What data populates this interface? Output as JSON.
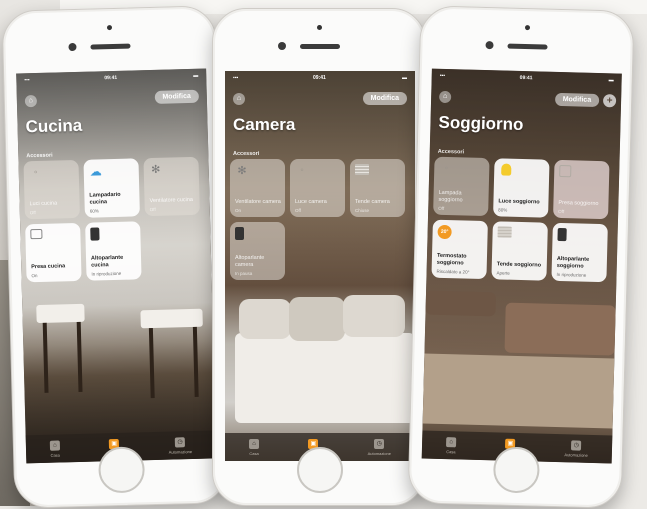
{
  "phones": [
    {
      "room": "Cucina",
      "edit_label": "Modifica",
      "status_time": "09:41",
      "section": "Accessori",
      "tiles": [
        {
          "name": "Luci cucina",
          "status": "Off",
          "icon": "bulb-icon",
          "state": "off"
        },
        {
          "name": "Lampadario cucina",
          "status": "60%",
          "icon": "cloud-icon",
          "state": "on"
        },
        {
          "name": "Ventilatore cucina",
          "status": "Off",
          "icon": "fan-icon",
          "state": "off"
        },
        {
          "name": "Presa cucina",
          "status": "On",
          "icon": "plug-icon",
          "state": "on"
        },
        {
          "name": "Altoparlante cucina",
          "status": "In riproduzione",
          "icon": "speaker-icon",
          "state": "on"
        }
      ],
      "tabs": [
        {
          "label": "Casa",
          "icon": "house-icon"
        },
        {
          "label": "Stanze",
          "icon": "rooms-icon",
          "active": true
        },
        {
          "label": "Automazione",
          "icon": "automation-icon"
        }
      ]
    },
    {
      "room": "Camera",
      "edit_label": "Modifica",
      "status_time": "09:41",
      "section": "Accessori",
      "tiles": [
        {
          "name": "Ventilatore camera",
          "status": "On",
          "icon": "fan-icon",
          "state": "off"
        },
        {
          "name": "Luce camera",
          "status": "Off",
          "icon": "bulb-icon",
          "state": "off"
        },
        {
          "name": "Tende camera",
          "status": "Chiuse",
          "icon": "blinds-icon",
          "state": "off"
        },
        {
          "name": "Altoparlante camera",
          "status": "In pausa",
          "icon": "speaker-icon",
          "state": "off"
        }
      ],
      "tabs": [
        {
          "label": "Casa",
          "icon": "house-icon"
        },
        {
          "label": "Stanze",
          "icon": "rooms-icon",
          "active": true
        },
        {
          "label": "Automazione",
          "icon": "automation-icon"
        }
      ]
    },
    {
      "room": "Soggiorno",
      "edit_label": "Modifica",
      "status_time": "09:41",
      "section": "Accessori",
      "tiles": [
        {
          "name": "Lampada soggiorno",
          "status": "Off",
          "icon": "bulb-icon",
          "state": "off"
        },
        {
          "name": "Luce soggiorno",
          "status": "80%",
          "icon": "bulb-on-icon",
          "state": "on"
        },
        {
          "name": "Presa soggiorno",
          "status": "Off",
          "icon": "frame-icon",
          "state": "off-pink"
        },
        {
          "name": "Termostato soggiorno",
          "status": "Riscaldato a 20°",
          "icon": "thermostat-icon",
          "state": "on"
        },
        {
          "name": "Tende soggiorno",
          "status": "Aperte",
          "icon": "blinds-icon",
          "state": "on"
        },
        {
          "name": "Altoparlante soggiorno",
          "status": "In riproduzione",
          "icon": "speaker-icon",
          "state": "on"
        }
      ],
      "tabs": [
        {
          "label": "Casa",
          "icon": "house-icon"
        },
        {
          "label": "Stanze",
          "icon": "rooms-icon",
          "active": true
        },
        {
          "label": "Automazione",
          "icon": "automation-icon"
        }
      ]
    }
  ],
  "thermostat_badge": "20°",
  "colors": {
    "accent": "#f29a23",
    "bulb": "#f4cb2c",
    "cloud": "#3b9ad9"
  }
}
